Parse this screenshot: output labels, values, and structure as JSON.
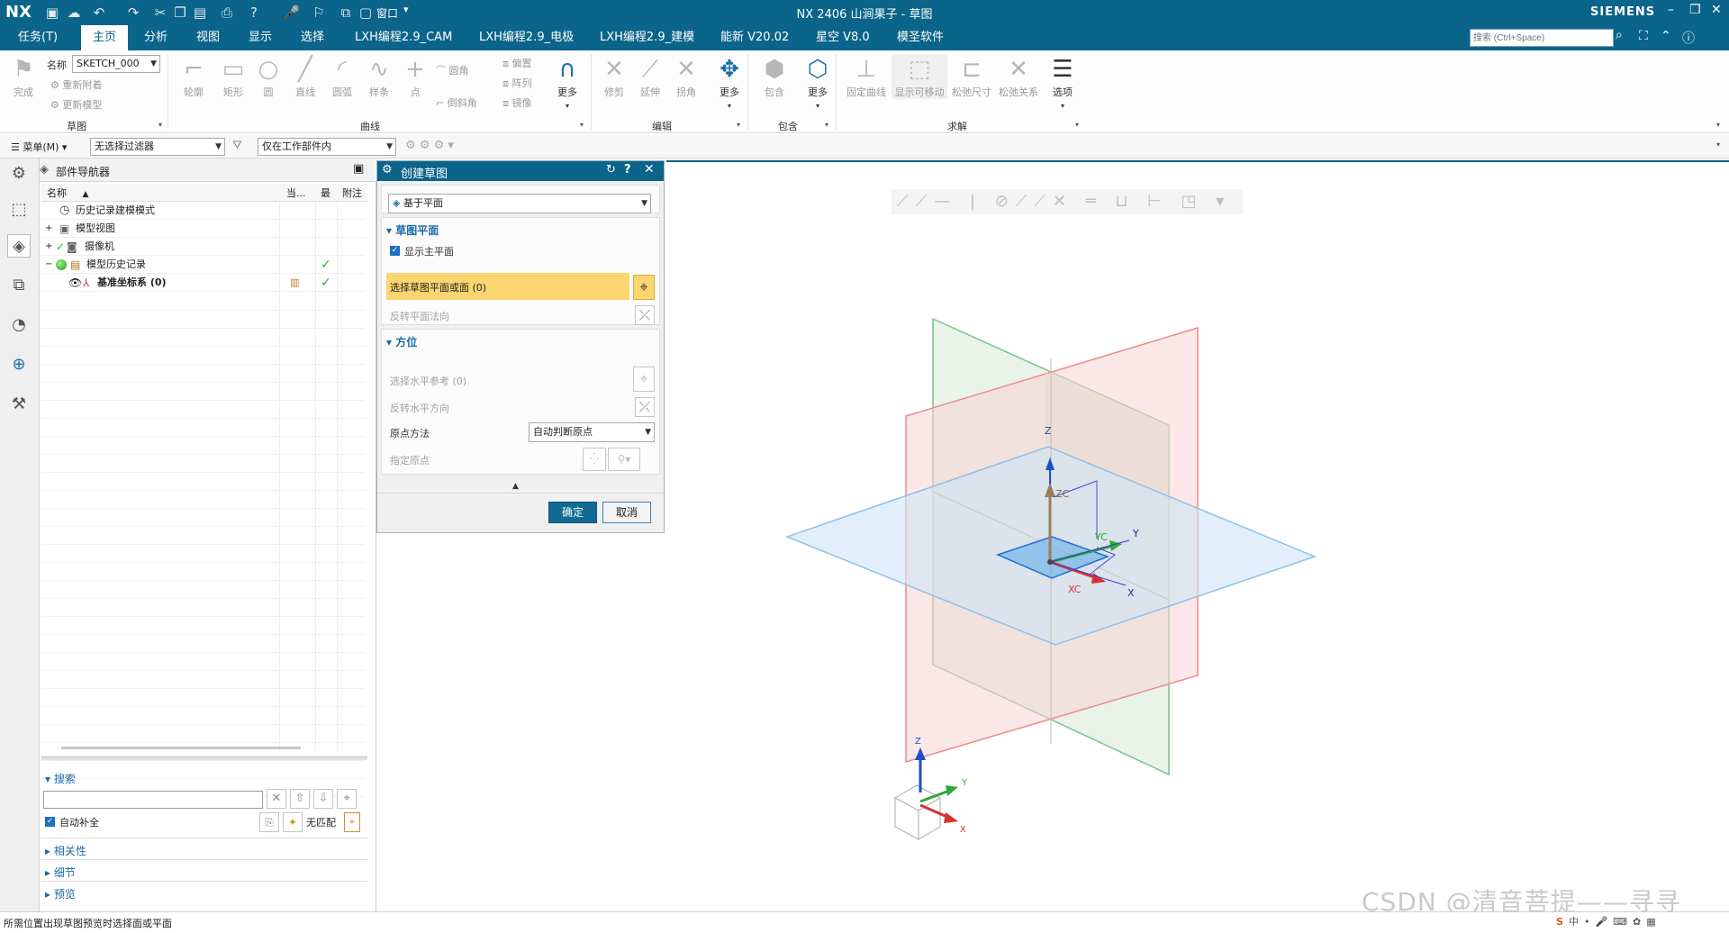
{
  "title_bar": {
    "logo": "NX",
    "window_menu": "窗口",
    "title": "NX 2406 山涧果子 - 草图",
    "brand": "SIEMENS",
    "icons": [
      "save-icon",
      "undo-icon",
      "redo-icon",
      "help-icon",
      "microphone-icon",
      "window-icon"
    ]
  },
  "menu": {
    "items": [
      "任务(T)",
      "主页",
      "分析",
      "视图",
      "显示",
      "选择",
      "LXH编程2.9_CAM",
      "LXH编程2.9_电极",
      "LXH编程2.9_建模",
      "能新 V20.02",
      "星空 V8.0",
      "模圣软件"
    ],
    "active": "主页",
    "search_placeholder": "搜索 (Ctrl+Space)"
  },
  "ribbon": {
    "sketch_group": {
      "finish": "完成",
      "name_label": "名称",
      "name_value": "SKETCH_000",
      "reattach": "重新附着",
      "update_model": "更新模型",
      "label": "草图"
    },
    "curve_group": {
      "buttons": [
        "轮廓",
        "矩形",
        "圆",
        "直线",
        "圆弧",
        "样条",
        "点"
      ],
      "small": [
        "圆角",
        "倒斜角",
        "偏置",
        "阵列",
        "镜像"
      ],
      "more": "更多",
      "label": "曲线"
    },
    "edit_group": {
      "buttons": [
        "修剪",
        "延伸",
        "拐角"
      ],
      "more": "更多",
      "label": "编辑"
    },
    "include_group": {
      "buttons": [
        "包含"
      ],
      "more": "更多",
      "label": "包含"
    },
    "solve_group": {
      "buttons": [
        "固定曲线",
        "显示可移动",
        "松弛尺寸",
        "松弛关系",
        "选项"
      ],
      "label": "求解"
    }
  },
  "selection_bar": {
    "menu": "菜单(M)",
    "filter": "无选择过滤器",
    "scope": "仅在工作部件内"
  },
  "navigator": {
    "title": "部件导航器",
    "columns": [
      "名称",
      "当...",
      "最",
      "附注"
    ],
    "rows": [
      {
        "label": "历史记录建模模式",
        "level": 0
      },
      {
        "label": "模型视图",
        "level": 0
      },
      {
        "label": "摄像机",
        "level": 0
      },
      {
        "label": "模型历史记录",
        "level": 0,
        "check": "✓"
      },
      {
        "label": "基准坐标系 (0)",
        "level": 1,
        "check": "✓"
      }
    ],
    "search": {
      "title": "搜索",
      "auto_complete": "自动补全",
      "no_match": "无匹配"
    },
    "panels": [
      "相关性",
      "细节",
      "预览"
    ]
  },
  "dialog": {
    "title": "创建草图",
    "type": "基于平面",
    "sketch_plane": {
      "title": "草图平面",
      "show_main_plane": "显示主平面",
      "select_plane": "选择草图平面或面 (0)",
      "reverse_normal": "反转平面法向"
    },
    "orientation": {
      "title": "方位",
      "select_horizontal": "选择水平参考 (0)",
      "reverse_horizontal": "反转水平方向",
      "origin_method_label": "原点方法",
      "origin_method_value": "自动判断原点",
      "specify_origin": "指定原点"
    },
    "ok": "确定",
    "cancel": "取消"
  },
  "graphics": {
    "axes": {
      "z": "Z",
      "y": "Y",
      "x": "X",
      "zc": "ZC",
      "yc": "YC",
      "xc": "XC"
    },
    "triad": {
      "z": "Z",
      "y": "Y",
      "x": "X"
    },
    "watermark": "CSDN @清音菩提——寻寻"
  },
  "status": {
    "text": "所需位置出现草图预览时选择面或平面"
  },
  "colors": {
    "titlebar": "#0b6489",
    "plane_xy": "#a9d0ee",
    "plane_xz": "#f08c8c",
    "plane_yz": "#8ac48f",
    "highlight": "#fbd56f"
  }
}
